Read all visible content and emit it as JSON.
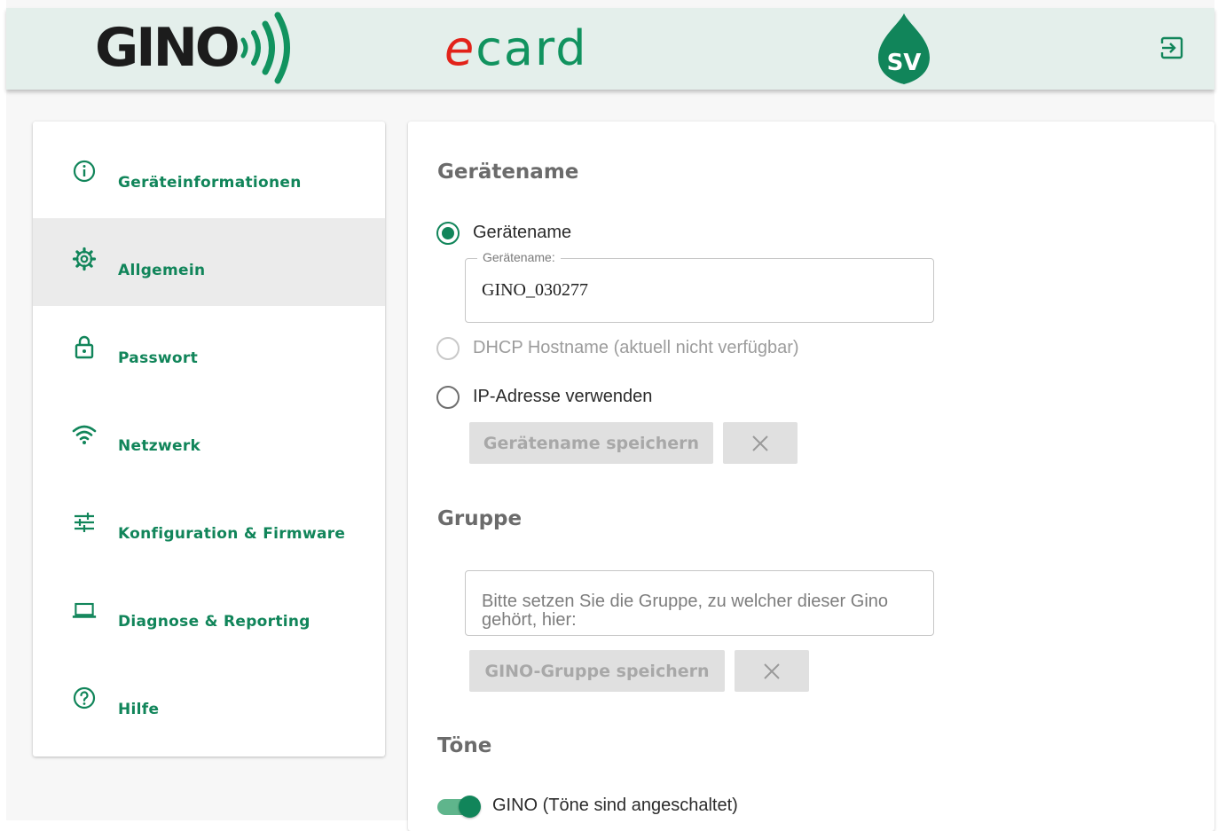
{
  "header": {
    "logo_gino": "GINO",
    "logo_ecard": "ecard",
    "logo_sv": "SV",
    "logout_icon": "logout-icon"
  },
  "sidebar": {
    "items": [
      {
        "label": "Geräteinformationen",
        "icon": "info-icon"
      },
      {
        "label": "Allgemein",
        "icon": "gear-icon",
        "active": true
      },
      {
        "label": "Passwort",
        "icon": "lock-icon"
      },
      {
        "label": "Netzwerk",
        "icon": "wifi-icon"
      },
      {
        "label": "Konfiguration & Firmware",
        "icon": "sliders-icon"
      },
      {
        "label": "Diagnose & Reporting",
        "icon": "laptop-icon"
      },
      {
        "label": "Hilfe",
        "icon": "help-icon"
      }
    ]
  },
  "main": {
    "device_name": {
      "title": "Gerätename",
      "option_name": "Gerätename",
      "field_legend": "Gerätename:",
      "field_value": "GINO_030277",
      "option_dhcp": "DHCP Hostname (aktuell nicht verfügbar)",
      "option_ip": "IP-Adresse verwenden",
      "save_label": "Gerätename speichern"
    },
    "group": {
      "title": "Gruppe",
      "placeholder": "Bitte setzen Sie die Gruppe, zu welcher dieser Gino gehört, hier:",
      "save_label": "GINO-Gruppe speichern"
    },
    "tones": {
      "title": "Töne",
      "toggle_label": "GINO (Töne sind angeschaltet)",
      "enabled": true
    }
  },
  "colors": {
    "accent": "#11855a",
    "header_bg": "#e4efeb",
    "ecard_e": "#e2231a"
  }
}
